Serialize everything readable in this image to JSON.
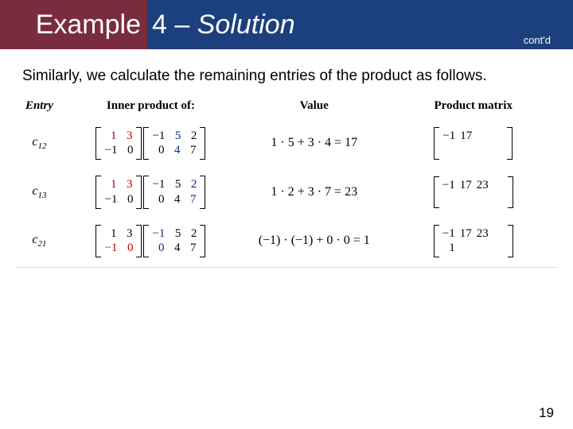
{
  "header": {
    "title_left": "Example",
    "title_right_num": "4",
    "title_right_dash": " – ",
    "title_right_italic": "Solution",
    "contd": "cont'd"
  },
  "intro": "Similarly, we calculate the remaining entries of the product as follows.",
  "columns": {
    "entry": "Entry",
    "inner": "Inner product of:",
    "value": "Value",
    "product": "Product matrix"
  },
  "matrix_A": {
    "rows": [
      [
        "1",
        "3"
      ],
      [
        "−1",
        "0"
      ]
    ]
  },
  "matrix_B": {
    "rows": [
      [
        "−1",
        "5",
        "2"
      ],
      [
        "0",
        "4",
        "7"
      ]
    ]
  },
  "rows": [
    {
      "entry_base": "c",
      "entry_sub": "12",
      "hl_A_row": 0,
      "hl_B_col": 1,
      "value_expr": "1 · 5 + 3 · 4 = 17",
      "product": [
        [
          "−1",
          "17",
          "",
          ""
        ],
        [
          "",
          "",
          "",
          ""
        ]
      ]
    },
    {
      "entry_base": "c",
      "entry_sub": "13",
      "hl_A_row": 0,
      "hl_B_col": 2,
      "value_expr": "1 · 2 + 3 · 7 = 23",
      "product": [
        [
          "−1",
          "17",
          "23",
          ""
        ],
        [
          "",
          "",
          "",
          ""
        ]
      ]
    },
    {
      "entry_base": "c",
      "entry_sub": "21",
      "hl_A_row": 1,
      "hl_B_col": 0,
      "value_expr": "(−1) · (−1) + 0 · 0 = 1",
      "product": [
        [
          "−1",
          "17",
          "23",
          ""
        ],
        [
          "1",
          "",
          "",
          ""
        ]
      ]
    }
  ],
  "page_number": "19",
  "chart_data": {
    "type": "table",
    "title": "Matrix product entries c_ij",
    "columns": [
      "Entry",
      "Inner product of",
      "Value",
      "Product matrix"
    ],
    "matrix_A": [
      [
        1,
        3
      ],
      [
        -1,
        0
      ]
    ],
    "matrix_B": [
      [
        -1,
        5,
        2
      ],
      [
        0,
        4,
        7
      ]
    ],
    "rows": [
      {
        "entry": "c12",
        "highlight_A_row": 1,
        "highlight_B_col": 2,
        "computation": "1*5+3*4",
        "value": 17,
        "product_so_far": [
          [
            -1,
            17,
            null
          ],
          [
            null,
            null,
            null
          ]
        ]
      },
      {
        "entry": "c13",
        "highlight_A_row": 1,
        "highlight_B_col": 3,
        "computation": "1*2+3*7",
        "value": 23,
        "product_so_far": [
          [
            -1,
            17,
            23
          ],
          [
            null,
            null,
            null
          ]
        ]
      },
      {
        "entry": "c21",
        "highlight_A_row": 2,
        "highlight_B_col": 1,
        "computation": "(-1)*(-1)+0*0",
        "value": 1,
        "product_so_far": [
          [
            -1,
            17,
            23
          ],
          [
            1,
            null,
            null
          ]
        ]
      }
    ]
  }
}
